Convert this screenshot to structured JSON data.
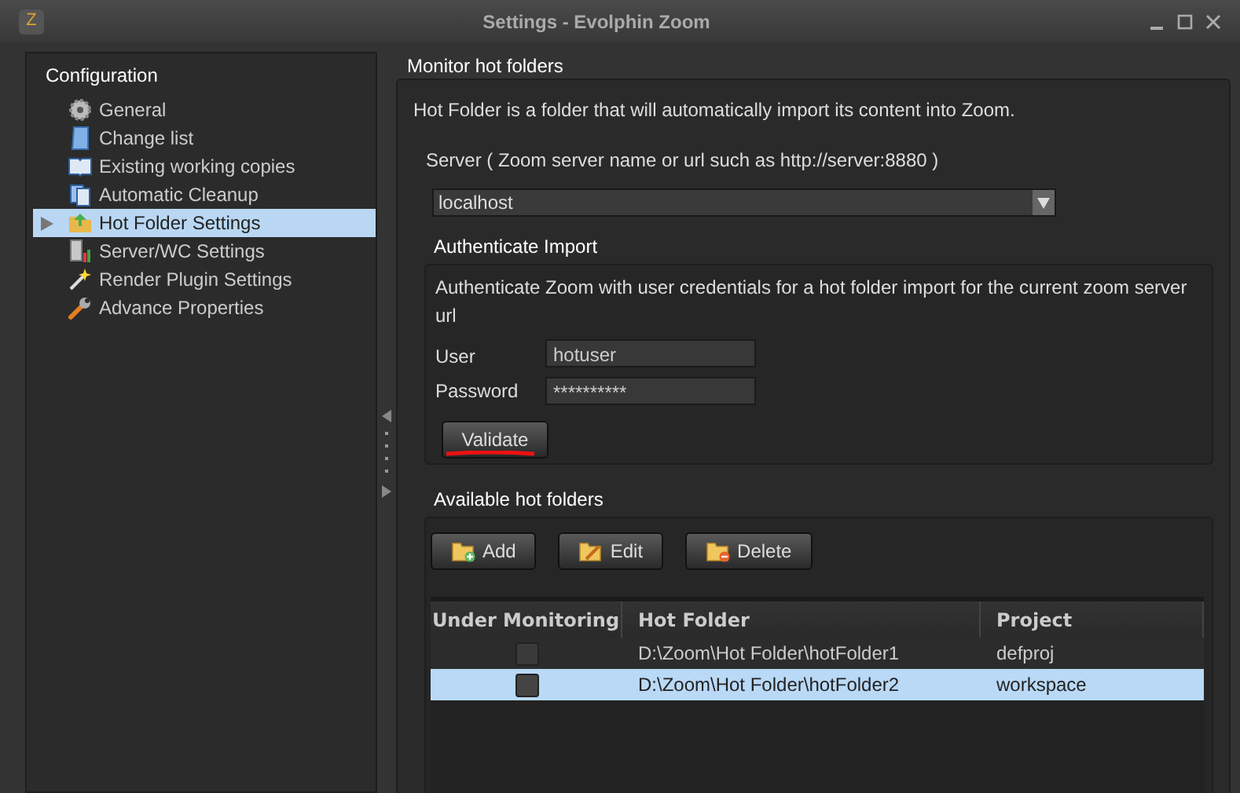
{
  "window": {
    "title": "Settings - Evolphin Zoom",
    "logo": "Z"
  },
  "sidebar": {
    "title": "Configuration",
    "items": [
      {
        "label": "General",
        "kind": "gear",
        "selected": false
      },
      {
        "label": "Change list",
        "kind": "scroll",
        "selected": false
      },
      {
        "label": "Existing working copies",
        "kind": "book",
        "selected": false
      },
      {
        "label": "Automatic Cleanup",
        "kind": "docs",
        "selected": false
      },
      {
        "label": "Hot Folder Settings",
        "kind": "folder",
        "selected": true
      },
      {
        "label": "Server/WC Settings",
        "kind": "server",
        "selected": false
      },
      {
        "label": "Render Plugin Settings",
        "kind": "wand",
        "selected": false
      },
      {
        "label": "Advance Properties",
        "kind": "wrench",
        "selected": false
      }
    ]
  },
  "main": {
    "title": "Monitor hot folders",
    "description": "Hot Folder is a folder that will automatically import its content into Zoom.",
    "server_label": "Server ( Zoom server name or url such as http://server:8880 )",
    "server_value": "localhost"
  },
  "authenticate": {
    "title": "Authenticate Import",
    "description": "Authenticate Zoom with user credentials for a hot folder import for the current zoom server url",
    "user_label": "User",
    "user_value": "hotuser",
    "password_label": "Password",
    "password_value": "**********",
    "validate_button": "Validate"
  },
  "hot_folders": {
    "title": "Available hot folders",
    "buttons": [
      {
        "label": "Add",
        "kind": "add"
      },
      {
        "label": "Edit",
        "kind": "edit"
      },
      {
        "label": "Delete",
        "kind": "delete"
      }
    ],
    "table": {
      "columns": [
        "Under Monitoring",
        "Hot Folder",
        "Project"
      ],
      "rows": [
        {
          "checked": false,
          "folder": "D:\\Zoom\\Hot Folder\\hotFolder1",
          "project": "defproj",
          "selected": false
        },
        {
          "checked": false,
          "folder": "D:\\Zoom\\Hot Folder\\hotFolder2",
          "project": "workspace",
          "selected": true
        }
      ]
    }
  }
}
